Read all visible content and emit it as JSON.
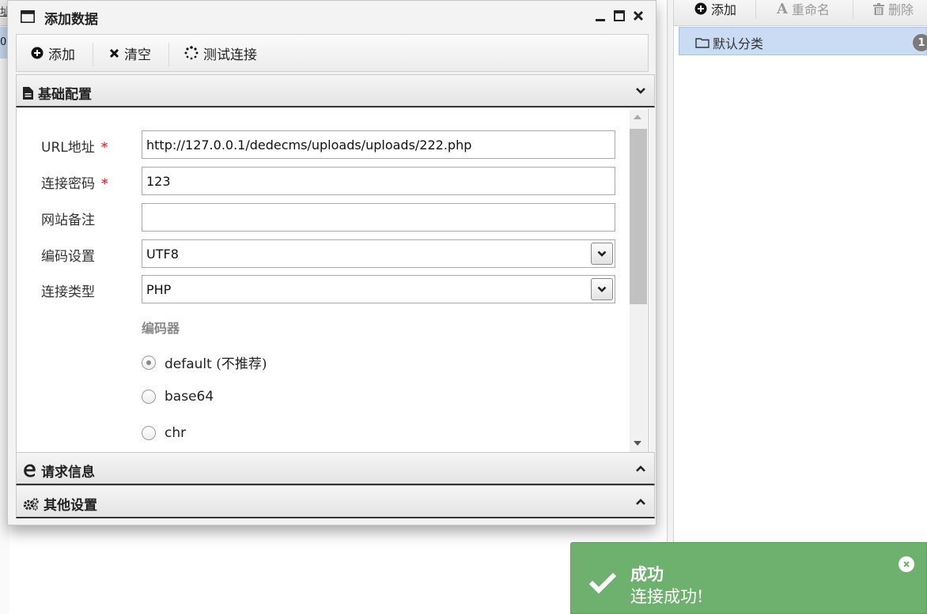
{
  "background": {
    "left_header_fragment": "址",
    "left_row_fragment": "0"
  },
  "right_panel": {
    "toolbar": {
      "add_label": "添加",
      "rename_label": "重命名",
      "delete_label": "删除"
    },
    "categories": [
      {
        "label": "默认分类",
        "count": "1"
      }
    ]
  },
  "dialog": {
    "title": "添加数据",
    "toolbar": {
      "add_label": "添加",
      "clear_label": "清空",
      "test_label": "测试连接"
    },
    "sections": {
      "basic": "基础配置",
      "request": "请求信息",
      "other": "其他设置"
    },
    "form": {
      "url_label": "URL地址",
      "url_value": "http://127.0.0.1/dedecms/uploads/uploads/222.php",
      "password_label": "连接密码",
      "password_value": "123",
      "note_label": "网站备注",
      "note_value": "",
      "encoding_label": "编码设置",
      "encoding_value": "UTF8",
      "type_label": "连接类型",
      "type_value": "PHP",
      "required_mark": "*",
      "encoder_title": "编码器",
      "encoders": [
        {
          "label": "default",
          "note": "(不推荐)",
          "checked": true
        },
        {
          "label": "base64",
          "note": "",
          "checked": false
        },
        {
          "label": "chr",
          "note": "",
          "checked": false
        }
      ]
    }
  },
  "toast": {
    "title": "成功",
    "message": "连接成功!",
    "color": "#6eb06e"
  }
}
